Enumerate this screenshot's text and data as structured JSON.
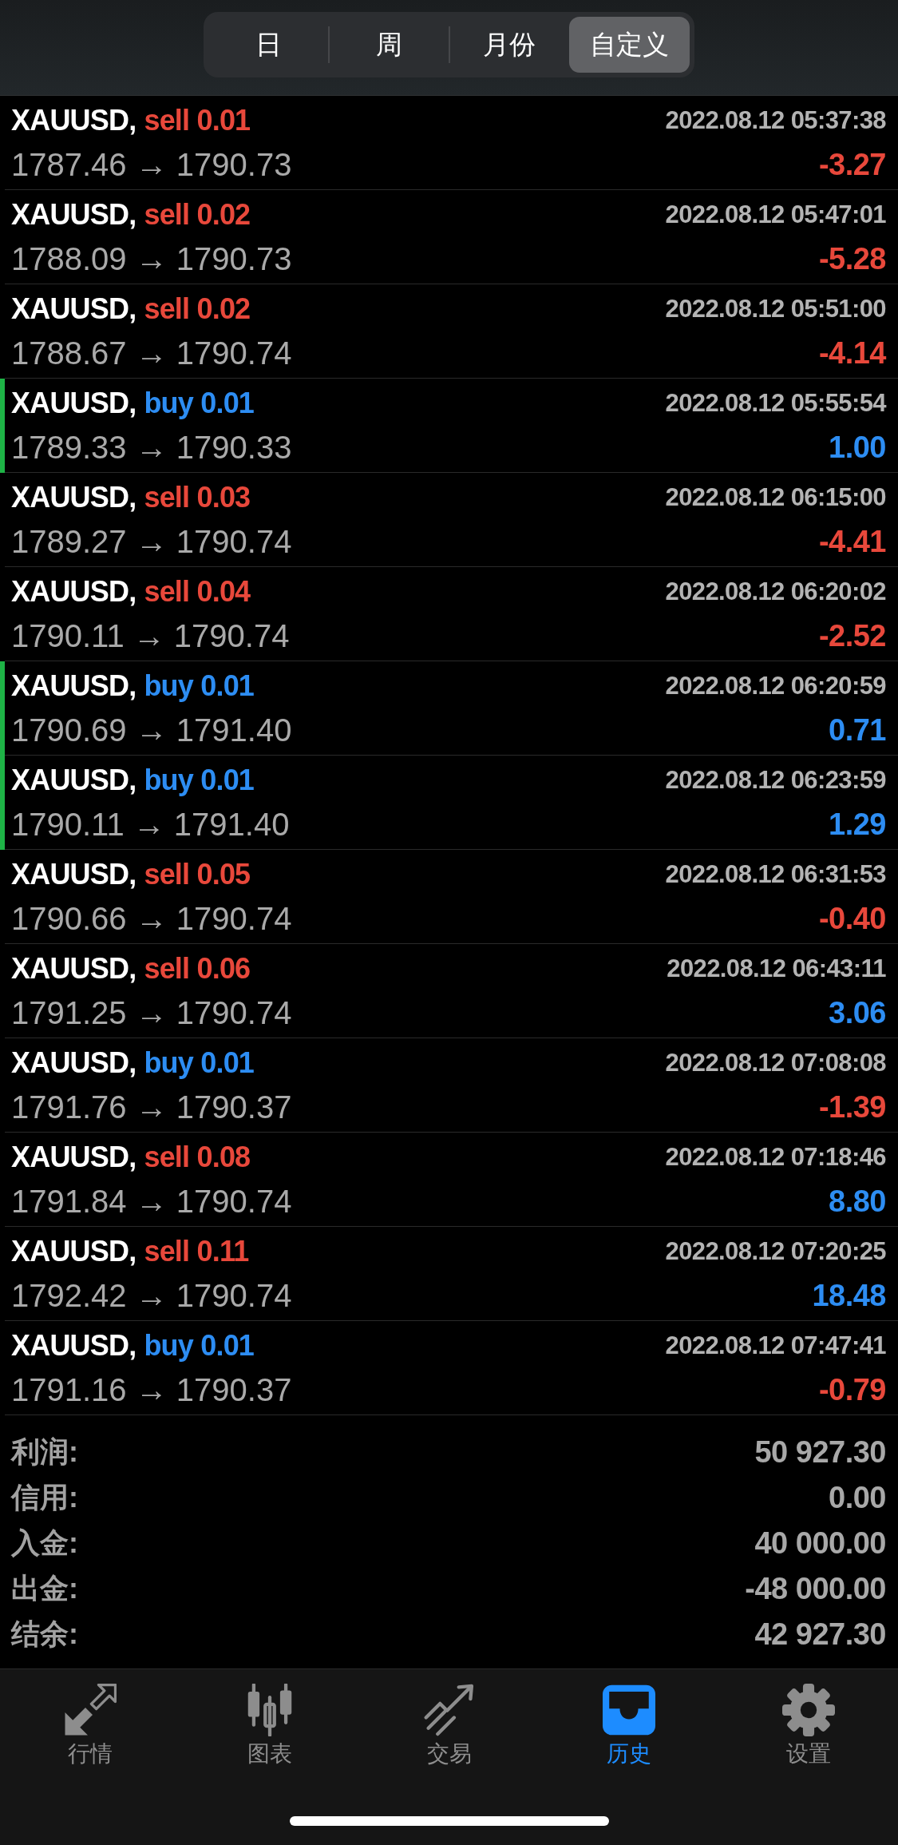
{
  "period_tabs": [
    {
      "label": "日",
      "selected": false
    },
    {
      "label": "周",
      "selected": false
    },
    {
      "label": "月份",
      "selected": false
    },
    {
      "label": "自定义",
      "selected": true
    }
  ],
  "deals": [
    {
      "symbol": "XAUUSD,",
      "kind": "sell",
      "order": "sell 0.01",
      "time": "2022.08.12 05:37:38",
      "prices": "1787.46 → 1790.73",
      "profit": "-3.27",
      "color": "#e8483b",
      "marked": false
    },
    {
      "symbol": "XAUUSD,",
      "kind": "sell",
      "order": "sell 0.02",
      "time": "2022.08.12 05:47:01",
      "prices": "1788.09 → 1790.73",
      "profit": "-5.28",
      "color": "#e8483b",
      "marked": false
    },
    {
      "symbol": "XAUUSD,",
      "kind": "sell",
      "order": "sell 0.02",
      "time": "2022.08.12 05:51:00",
      "prices": "1788.67 → 1790.74",
      "profit": "-4.14",
      "color": "#e8483b",
      "marked": false
    },
    {
      "symbol": "XAUUSD,",
      "kind": "buy",
      "order": "buy 0.01",
      "time": "2022.08.12 05:55:54",
      "prices": "1789.33 → 1790.33",
      "profit": "1.00",
      "color": "#2d8df3",
      "marked": true
    },
    {
      "symbol": "XAUUSD,",
      "kind": "sell",
      "order": "sell 0.03",
      "time": "2022.08.12 06:15:00",
      "prices": "1789.27 → 1790.74",
      "profit": "-4.41",
      "color": "#e8483b",
      "marked": false
    },
    {
      "symbol": "XAUUSD,",
      "kind": "sell",
      "order": "sell 0.04",
      "time": "2022.08.12 06:20:02",
      "prices": "1790.11 → 1790.74",
      "profit": "-2.52",
      "color": "#e8483b",
      "marked": false
    },
    {
      "symbol": "XAUUSD,",
      "kind": "buy",
      "order": "buy 0.01",
      "time": "2022.08.12 06:20:59",
      "prices": "1790.69 → 1791.40",
      "profit": "0.71",
      "color": "#2d8df3",
      "marked": true
    },
    {
      "symbol": "XAUUSD,",
      "kind": "buy",
      "order": "buy 0.01",
      "time": "2022.08.12 06:23:59",
      "prices": "1790.11 → 1791.40",
      "profit": "1.29",
      "color": "#2d8df3",
      "marked": true
    },
    {
      "symbol": "XAUUSD,",
      "kind": "sell",
      "order": "sell 0.05",
      "time": "2022.08.12 06:31:53",
      "prices": "1790.66 → 1790.74",
      "profit": "-0.40",
      "color": "#e8483b",
      "marked": false
    },
    {
      "symbol": "XAUUSD,",
      "kind": "sell",
      "order": "sell 0.06",
      "time": "2022.08.12 06:43:11",
      "prices": "1791.25 → 1790.74",
      "profit": "3.06",
      "color": "#2d8df3",
      "marked": false
    },
    {
      "symbol": "XAUUSD,",
      "kind": "buy",
      "order": "buy 0.01",
      "time": "2022.08.12 07:08:08",
      "prices": "1791.76 → 1790.37",
      "profit": "-1.39",
      "color": "#e8483b",
      "marked": false
    },
    {
      "symbol": "XAUUSD,",
      "kind": "sell",
      "order": "sell 0.08",
      "time": "2022.08.12 07:18:46",
      "prices": "1791.84 → 1790.74",
      "profit": "8.80",
      "color": "#2d8df3",
      "marked": false
    },
    {
      "symbol": "XAUUSD,",
      "kind": "sell",
      "order": "sell 0.11",
      "time": "2022.08.12 07:20:25",
      "prices": "1792.42 → 1790.74",
      "profit": "18.48",
      "color": "#2d8df3",
      "marked": false
    },
    {
      "symbol": "XAUUSD,",
      "kind": "buy",
      "order": "buy 0.01",
      "time": "2022.08.12 07:47:41",
      "prices": "1791.16 → 1790.37",
      "profit": "-0.79",
      "color": "#e8483b",
      "marked": false
    }
  ],
  "summary": [
    {
      "label": "利润:",
      "value": "50 927.30"
    },
    {
      "label": "信用:",
      "value": "0.00"
    },
    {
      "label": "入金:",
      "value": "40 000.00"
    },
    {
      "label": "出金:",
      "value": "-48 000.00"
    },
    {
      "label": "结余:",
      "value": "42 927.30"
    }
  ],
  "tab_bar": [
    {
      "label": "行情",
      "kind": "quotes",
      "selected": false
    },
    {
      "label": "图表",
      "kind": "chart",
      "selected": false
    },
    {
      "label": "交易",
      "kind": "trade",
      "selected": false
    },
    {
      "label": "历史",
      "kind": "history",
      "selected": true
    },
    {
      "label": "设置",
      "kind": "settings",
      "selected": false
    }
  ]
}
